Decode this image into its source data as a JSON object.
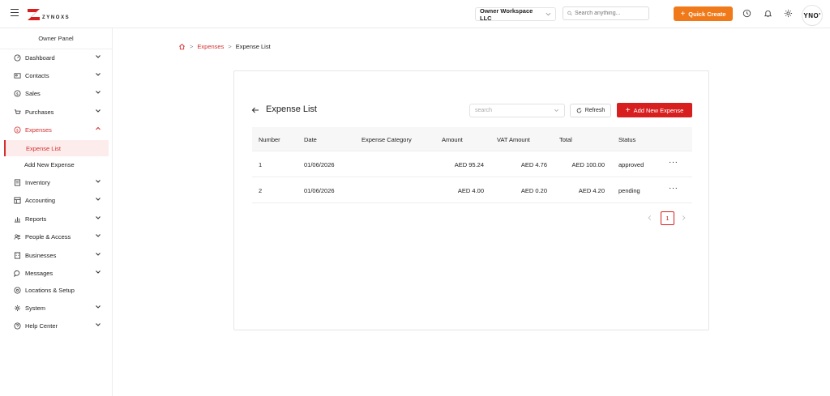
{
  "brand": {
    "name": "ZYNOXS",
    "accent": "#d71f1f"
  },
  "header": {
    "workspace": "Owner Workspace LLC",
    "search_placeholder": "Search anything...",
    "quick_create": "Quick Create",
    "avatar_initials": "YNO'"
  },
  "sidebar": {
    "panel_title": "Owner Panel",
    "items": [
      {
        "label": "Dashboard",
        "icon": "dashboard-icon"
      },
      {
        "label": "Contacts",
        "icon": "contacts-icon"
      },
      {
        "label": "Sales",
        "icon": "sales-icon"
      },
      {
        "label": "Purchases",
        "icon": "purchases-icon"
      },
      {
        "label": "Expenses",
        "icon": "expenses-icon"
      },
      {
        "label": "Inventory",
        "icon": "inventory-icon"
      },
      {
        "label": "Accounting",
        "icon": "accounting-icon"
      },
      {
        "label": "Reports",
        "icon": "reports-icon"
      },
      {
        "label": "People & Access",
        "icon": "people-icon"
      },
      {
        "label": "Businesses",
        "icon": "businesses-icon"
      },
      {
        "label": "Messages",
        "icon": "messages-icon"
      },
      {
        "label": "Locations & Setup",
        "icon": "location-icon"
      },
      {
        "label": "System",
        "icon": "system-icon"
      },
      {
        "label": "Help Center",
        "icon": "help-icon"
      }
    ],
    "expenses_sub": [
      "Expense List",
      "Add New Expense"
    ]
  },
  "breadcrumb": {
    "section": "Expenses",
    "current": "Expense List"
  },
  "main": {
    "title": "Expense List",
    "filter_placeholder": "search",
    "refresh": "Refresh",
    "add_new": "Add New Expense",
    "columns": [
      "Number",
      "Date",
      "Expense Category",
      "Amount",
      "VAT Amount",
      "Total",
      "Status"
    ],
    "rows": [
      {
        "number": "1",
        "date": "01/06/2026",
        "category": "",
        "amount": "AED 95.24",
        "vat": "AED 4.76",
        "total": "AED 100.00",
        "status": "approved"
      },
      {
        "number": "2",
        "date": "01/06/2026",
        "category": "",
        "amount": "AED 4.00",
        "vat": "AED 0.20",
        "total": "AED 4.20",
        "status": "pending"
      }
    ],
    "page": "1",
    "row_menu": "···"
  }
}
